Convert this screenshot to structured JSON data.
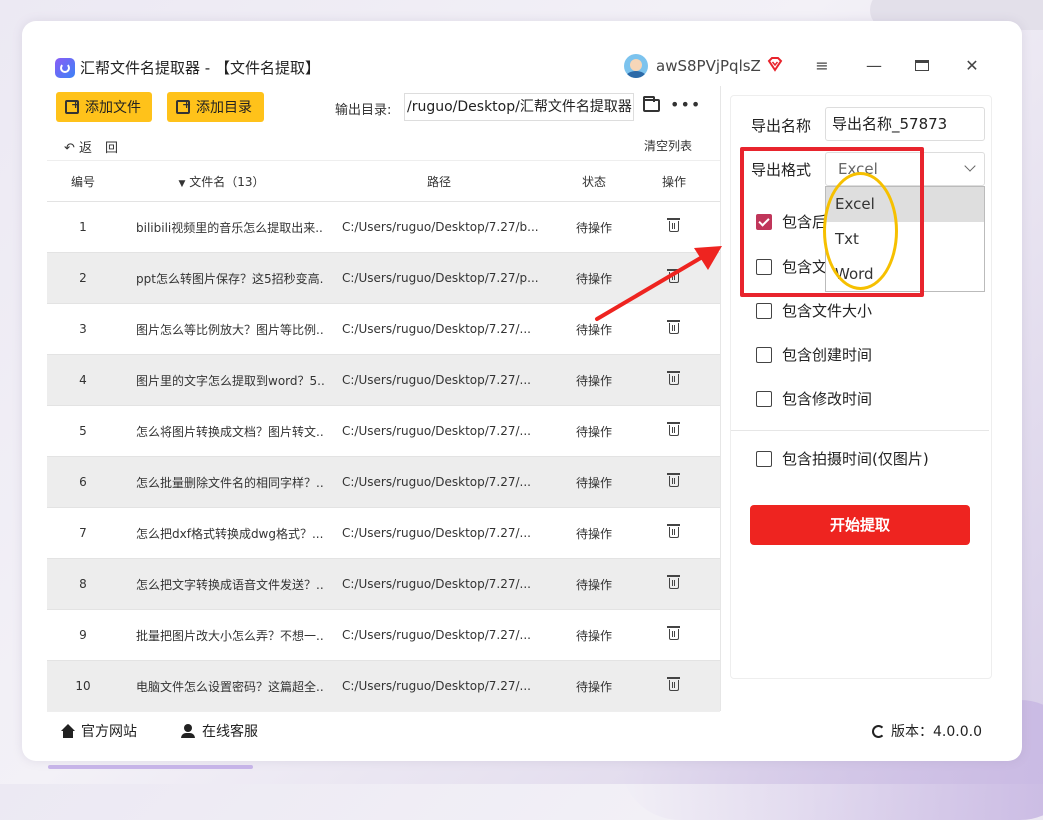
{
  "window": {
    "title": "汇帮文件名提取器 - 【文件名提取】",
    "username": "awS8PVjPqlsZ"
  },
  "toolbar": {
    "add_file": "添加文件",
    "add_dir": "添加目录",
    "output_label": "输出目录:",
    "output_path": "/ruguo/Desktop/汇帮文件名提取器",
    "back": "返　回",
    "clear_list": "清空列表"
  },
  "table": {
    "headers": {
      "no": "编号",
      "name": "文件名（13）",
      "path": "路径",
      "status": "状态",
      "op": "操作"
    },
    "rows": [
      {
        "no": "1",
        "name": "bilibili视频里的音乐怎么提取出来...",
        "path": "C:/Users/ruguo/Desktop/7.27/b...",
        "status": "待操作"
      },
      {
        "no": "2",
        "name": "ppt怎么转图片保存？这5招秒变高...",
        "path": "C:/Users/ruguo/Desktop/7.27/p...",
        "status": "待操作"
      },
      {
        "no": "3",
        "name": "图片怎么等比例放大？图片等比例...",
        "path": "C:/Users/ruguo/Desktop/7.27/...",
        "status": "待操作"
      },
      {
        "no": "4",
        "name": "图片里的文字怎么提取到word？5...",
        "path": "C:/Users/ruguo/Desktop/7.27/...",
        "status": "待操作"
      },
      {
        "no": "5",
        "name": "怎么将图片转换成文档？图片转文...",
        "path": "C:/Users/ruguo/Desktop/7.27/...",
        "status": "待操作"
      },
      {
        "no": "6",
        "name": "怎么批量删除文件名的相同字样？...",
        "path": "C:/Users/ruguo/Desktop/7.27/...",
        "status": "待操作"
      },
      {
        "no": "7",
        "name": "怎么把dxf格式转换成dwg格式？...",
        "path": "C:/Users/ruguo/Desktop/7.27/...",
        "status": "待操作"
      },
      {
        "no": "8",
        "name": "怎么把文字转换成语音文件发送？...",
        "path": "C:/Users/ruguo/Desktop/7.27/...",
        "status": "待操作"
      },
      {
        "no": "9",
        "name": "批量把图片改大小怎么弄？不想一...",
        "path": "C:/Users/ruguo/Desktop/7.27/...",
        "status": "待操作"
      },
      {
        "no": "10",
        "name": "电脑文件怎么设置密码？这篇超全...",
        "path": "C:/Users/ruguo/Desktop/7.27/...",
        "status": "待操作"
      }
    ]
  },
  "panel": {
    "export_name_label": "导出名称",
    "export_name_value": "导出名称_57873",
    "export_format_label": "导出格式",
    "export_format_value": "Excel",
    "format_options": [
      "Excel",
      "Txt",
      "Word"
    ],
    "options": [
      {
        "label": "包含后缀",
        "checked": true
      },
      {
        "label": "包含文件路径",
        "checked": false
      },
      {
        "label": "包含文件大小",
        "checked": false
      },
      {
        "label": "包含创建时间",
        "checked": false
      },
      {
        "label": "包含修改时间",
        "checked": false
      },
      {
        "label": "包含拍摄时间(仅图片)",
        "checked": false
      }
    ],
    "start_button": "开始提取"
  },
  "footer": {
    "website": "官方网站",
    "support": "在线客服",
    "version": "版本：4.0.0.0"
  },
  "colors": {
    "accent_yellow": "#ffc21a",
    "start_red": "#ee2420",
    "checkbox_pink": "#c0365a",
    "annotation_red": "#e8242d",
    "annotation_yellow": "#f6c000"
  }
}
